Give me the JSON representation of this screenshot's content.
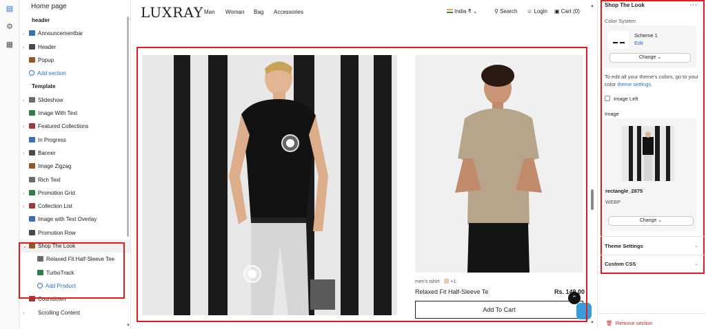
{
  "rail": {
    "icons": [
      "sections-icon",
      "settings-gear-icon",
      "apps-grid-icon"
    ]
  },
  "sidebar": {
    "title": "Home page",
    "groups": [
      {
        "label": "header",
        "items": [
          {
            "label": "Announcementbar",
            "icon": "announcement-bar-icon",
            "chevron": true
          },
          {
            "label": "Header",
            "icon": "header-layout-icon",
            "chevron": true
          },
          {
            "label": "Popup",
            "icon": "popup-icon",
            "chevron": false
          },
          {
            "label": "Add section",
            "icon": "plus-circle-icon",
            "add": true
          }
        ]
      },
      {
        "label": "Template",
        "items": [
          {
            "label": "Slideshow",
            "icon": "slideshow-icon",
            "chevron": true
          },
          {
            "label": "Image With Text",
            "icon": "image-text-icon",
            "chevron": false
          },
          {
            "label": "Featured Collections",
            "icon": "collections-icon",
            "chevron": true
          },
          {
            "label": "In Progress",
            "icon": "progress-icon",
            "chevron": false
          },
          {
            "label": "Banner",
            "icon": "banner-icon",
            "chevron": true
          },
          {
            "label": "Image Zigzag",
            "icon": "zigzag-icon",
            "chevron": false
          },
          {
            "label": "Rich Text",
            "icon": "rich-text-icon",
            "chevron": false
          },
          {
            "label": "Promotion Grid",
            "icon": "promotion-grid-icon",
            "chevron": true
          },
          {
            "label": "Collection List",
            "icon": "collection-list-icon",
            "chevron": true
          },
          {
            "label": "Image with Text Overlay",
            "icon": "overlay-icon",
            "chevron": false
          },
          {
            "label": "Promotion Row",
            "icon": "promotion-row-icon",
            "chevron": false
          },
          {
            "label": "Shop The Look",
            "icon": "shop-look-icon",
            "expanded": true,
            "selected": true
          },
          {
            "label": "Relaxed Fit Half-Sleeve Tee",
            "icon": "product-icon",
            "child": true
          },
          {
            "label": "TurboTrack",
            "icon": "product-icon",
            "child": true
          },
          {
            "label": "Add Product",
            "icon": "plus-circle-icon",
            "child": true,
            "add": true
          },
          {
            "label": "Countdown",
            "icon": "countdown-icon",
            "chevron": false
          },
          {
            "label": "Scrolling Content",
            "icon": "scroll-icon",
            "chevron": true,
            "noicon": true
          }
        ]
      }
    ]
  },
  "storefront": {
    "logo": "LUXRAY",
    "nav": [
      "Man",
      "Woman",
      "Bag",
      "Accessories"
    ],
    "region": "India ₹",
    "search": "Search",
    "login": "Login",
    "cart": "Cart (0)",
    "product": {
      "tag": "men's tshirt",
      "more_colors": "+1",
      "name": "Relaxed Fit Half-Sleeve Te",
      "price": "Rs. 149.00",
      "add_to_cart": "Add To Cart"
    }
  },
  "panel": {
    "title": "Shop The Look",
    "more": "···",
    "color_system_label": "Color System",
    "scheme_name": "Scheme 1",
    "scheme_edit": "Edit",
    "change_label": "Change",
    "theme_note_prefix": "To edit all your theme's colors, go to your color ",
    "theme_note_link": "theme settings",
    "theme_note_suffix": ".",
    "image_left_label": "Image Left",
    "image_label": "Image",
    "image_filename": "rectangle_2875",
    "image_format": "WEBP",
    "image_change_label": "Change",
    "theme_settings": "Theme Settings",
    "custom_css": "Custom CSS",
    "remove_section": "Remove section"
  },
  "colors": {
    "accent": "#2c6ecb",
    "highlight": "#e01b1b",
    "danger": "#d52020"
  }
}
